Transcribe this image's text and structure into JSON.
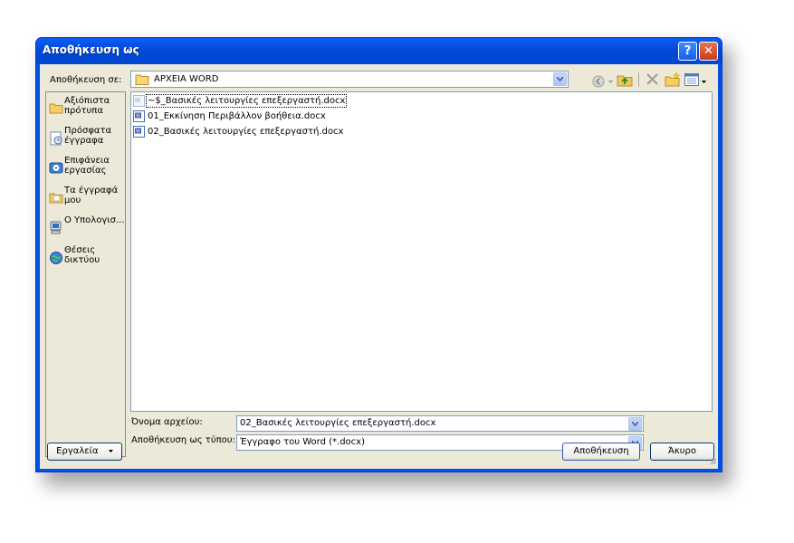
{
  "dialog": {
    "title": "Αποθήκευση ως",
    "help_label": "?",
    "close_label": "✕"
  },
  "save_in": {
    "label": "Αποθήκευση σε:",
    "value": "ΑΡΧΕΙΑ WORD"
  },
  "places": [
    {
      "label": "Αξιόπιστα πρότυπα",
      "icon": "folder-icon"
    },
    {
      "label": "Πρόσφατα έγγραφα",
      "icon": "recent-documents-icon"
    },
    {
      "label": "Επιφάνεια εργασίας",
      "icon": "desktop-icon"
    },
    {
      "label": "Τα έγγραφά μου",
      "icon": "my-documents-icon"
    },
    {
      "label": "Ο Υπολογισ...",
      "icon": "my-computer-icon"
    },
    {
      "label": "Θέσεις δικτύου",
      "icon": "network-places-icon"
    }
  ],
  "files": [
    {
      "name": "~$_Βασικές λειτουργίες επεξεργαστή.docx",
      "icon": "temp-document-icon"
    },
    {
      "name": "01_Εκκίνηση Περιβάλλον βοήθεια.docx",
      "icon": "word-document-icon"
    },
    {
      "name": "02_Βασικές λειτουργίες επεξεργαστή.docx",
      "icon": "word-document-icon"
    }
  ],
  "filename": {
    "label": "Όνομα αρχείου:",
    "value": "02_Βασικές λειτουργίες επεξεργαστή.docx"
  },
  "filetype": {
    "label": "Αποθήκευση ως τύπου:",
    "value": "Έγγραφο του Word (*.docx)"
  },
  "buttons": {
    "tools": "Εργαλεία",
    "save": "Αποθήκευση",
    "cancel": "Άκυρο"
  },
  "colors": {
    "title_bar": "#0054e3",
    "dialog_face": "#ece9d8",
    "close_button": "#c83a1c"
  }
}
